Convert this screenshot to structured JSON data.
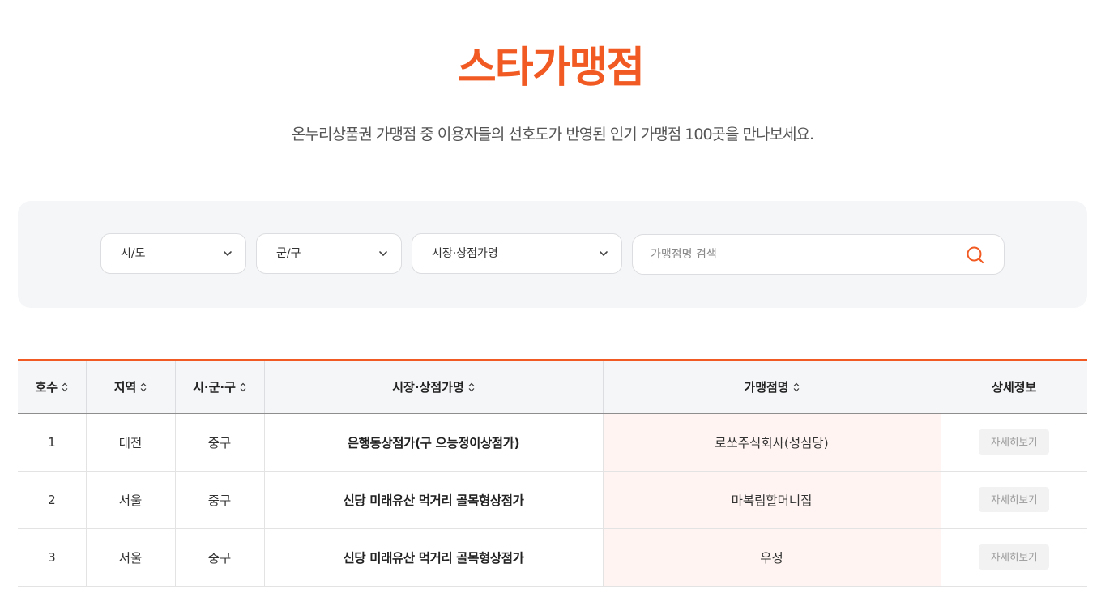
{
  "header": {
    "title": "스타가맹점",
    "subtitle": "온누리상품권 가맹점 중 이용자들의 선호도가 반영된 인기 가맹점 100곳을 만나보세요."
  },
  "filters": {
    "sido": {
      "label": "시/도",
      "icon": "chevron-down-icon"
    },
    "gungu": {
      "label": "군/구",
      "icon": "chevron-down-icon"
    },
    "market": {
      "label": "시장·상점가명",
      "icon": "chevron-down-icon"
    },
    "search": {
      "placeholder": "가맹점명 검색",
      "value": "",
      "icon": "search-icon"
    }
  },
  "table": {
    "columns": {
      "no": "호수",
      "region": "지역",
      "district": "시·군·구",
      "market": "시장·상점가명",
      "store": "가맹점명",
      "detail": "상세정보"
    },
    "rows": [
      {
        "no": "1",
        "region": "대전",
        "district": "중구",
        "market": "은행동상점가(구 으능정이상점가)",
        "store": "로쏘주식회사(성심당)",
        "detail": "자세히보기"
      },
      {
        "no": "2",
        "region": "서울",
        "district": "중구",
        "market": "신당 미래유산 먹거리 골목형상점가",
        "store": "마복림할머니집",
        "detail": "자세히보기"
      },
      {
        "no": "3",
        "region": "서울",
        "district": "중구",
        "market": "신당 미래유산 먹거리 골목형상점가",
        "store": "우정",
        "detail": "자세히보기"
      }
    ]
  },
  "colors": {
    "accent": "#f15a22",
    "store_cell_bg": "#fff4f1",
    "filter_bg": "#f5f6f8"
  }
}
